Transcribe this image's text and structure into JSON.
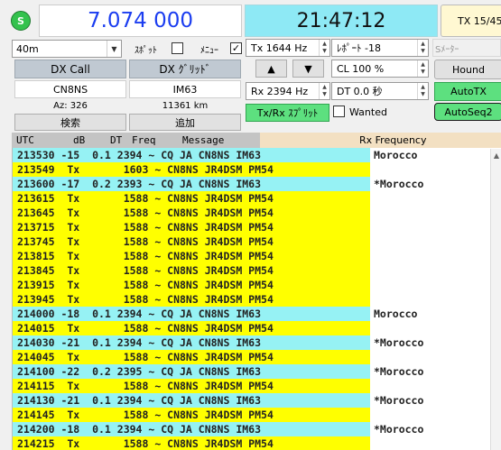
{
  "status": {
    "label": "S"
  },
  "dial_frequency": "7.074 000",
  "clock": "21:47:12",
  "tx_status": "TX 15/45",
  "band": {
    "value": "40m",
    "arrow": "▼"
  },
  "spot": {
    "label": "ｽﾎﾟｯﾄ",
    "checked": false
  },
  "menu": {
    "label": "ﾒﾆｭｰ",
    "checked": true
  },
  "tx_freq": {
    "value": "Tx  1644  Hz"
  },
  "report": {
    "value": "ﾚﾎﾟｰﾄ -18"
  },
  "s_meter": {
    "label": "Sﾒｰﾀｰ"
  },
  "dx_call_button": "DX Call",
  "dx_grid_button": "DX ｸﾞﾘｯﾄﾞ",
  "dx_call_value": "CN8NS",
  "dx_grid_value": "IM63",
  "azimuth": "Az: 326",
  "distance": "11361 km",
  "lookup_button": "検索",
  "add_button": "追加",
  "arrows": {
    "up": "▲",
    "down": "▼"
  },
  "cl": {
    "value": "CL  100 %"
  },
  "hound_button": "Hound",
  "rx_freq": {
    "value": "Rx  2394  Hz"
  },
  "dt": {
    "value": "DT 0.0 秒"
  },
  "autotx_button": "AutoTX",
  "split_button": "Tx/Rx ｽﾌﾟﾘｯﾄ",
  "wanted": {
    "label": "Wanted",
    "checked": false
  },
  "autoseq_button": "AutoSeq2",
  "columns": {
    "utc": "UTC",
    "db": "dB",
    "dt": "DT",
    "freq": "Freq",
    "message": "Message",
    "rx_freq_label": "Rx  Frequency"
  },
  "scroll_up": "▲",
  "decodes": [
    {
      "kind": "cq",
      "text": "213530 -15  0.1 2394 ~ CQ JA CN8NS IM63",
      "country": "Morocco"
    },
    {
      "kind": "tx",
      "text": "213549  Tx       1603 ~ CN8NS JR4DSM PM54",
      "country": ""
    },
    {
      "kind": "cq",
      "text": "213600 -17  0.2 2393 ~ CQ JA CN8NS IM63",
      "country": "*Morocco"
    },
    {
      "kind": "tx",
      "text": "213615  Tx       1588 ~ CN8NS JR4DSM PM54",
      "country": ""
    },
    {
      "kind": "tx",
      "text": "213645  Tx       1588 ~ CN8NS JR4DSM PM54",
      "country": ""
    },
    {
      "kind": "tx",
      "text": "213715  Tx       1588 ~ CN8NS JR4DSM PM54",
      "country": ""
    },
    {
      "kind": "tx",
      "text": "213745  Tx       1588 ~ CN8NS JR4DSM PM54",
      "country": ""
    },
    {
      "kind": "tx",
      "text": "213815  Tx       1588 ~ CN8NS JR4DSM PM54",
      "country": ""
    },
    {
      "kind": "tx",
      "text": "213845  Tx       1588 ~ CN8NS JR4DSM PM54",
      "country": ""
    },
    {
      "kind": "tx",
      "text": "213915  Tx       1588 ~ CN8NS JR4DSM PM54",
      "country": ""
    },
    {
      "kind": "tx",
      "text": "213945  Tx       1588 ~ CN8NS JR4DSM PM54",
      "country": ""
    },
    {
      "kind": "cq",
      "text": "214000 -18  0.1 2394 ~ CQ JA CN8NS IM63",
      "country": "Morocco"
    },
    {
      "kind": "tx",
      "text": "214015  Tx       1588 ~ CN8NS JR4DSM PM54",
      "country": ""
    },
    {
      "kind": "cq",
      "text": "214030 -21  0.1 2394 ~ CQ JA CN8NS IM63",
      "country": "*Morocco"
    },
    {
      "kind": "tx",
      "text": "214045  Tx       1588 ~ CN8NS JR4DSM PM54",
      "country": ""
    },
    {
      "kind": "cq",
      "text": "214100 -22  0.2 2395 ~ CQ JA CN8NS IM63",
      "country": "*Morocco"
    },
    {
      "kind": "tx",
      "text": "214115  Tx       1588 ~ CN8NS JR4DSM PM54",
      "country": ""
    },
    {
      "kind": "cq",
      "text": "214130 -21  0.1 2394 ~ CQ JA CN8NS IM63",
      "country": "*Morocco"
    },
    {
      "kind": "tx",
      "text": "214145  Tx       1588 ~ CN8NS JR4DSM PM54",
      "country": ""
    },
    {
      "kind": "cq",
      "text": "214200 -18  0.1 2394 ~ CQ JA CN8NS IM63",
      "country": "*Morocco"
    },
    {
      "kind": "tx",
      "text": "214215  Tx       1588 ~ CN8NS JR4DSM PM54",
      "country": ""
    }
  ]
}
